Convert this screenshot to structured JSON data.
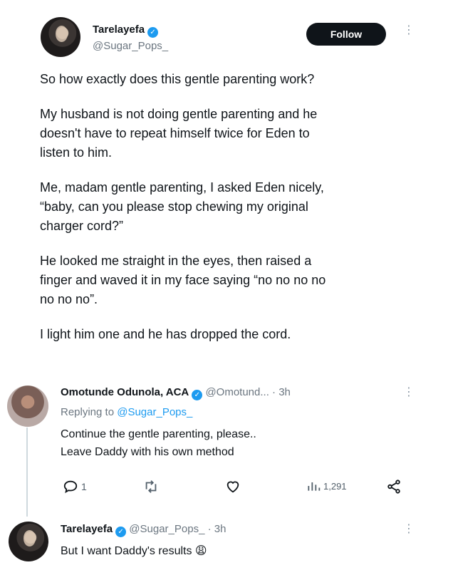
{
  "main_tweet": {
    "author_name": "Tarelayefa",
    "author_handle": "@Sugar_Pops_",
    "follow_label": "Follow",
    "paragraphs": [
      [
        "So how exactly does this gentle parenting work?"
      ],
      [
        "My husband is not doing gentle parenting and he",
        "doesn't have to repeat himself twice for Eden to",
        "listen to him."
      ],
      [
        "Me, madam gentle parenting, I asked Eden nicely,",
        "“baby, can you please stop chewing my original",
        "charger cord?”"
      ],
      [
        "He looked me straight in the eyes, then raised a",
        "finger and waved it in my face saying “no no no no",
        "no no no”."
      ],
      [
        "I light him one and he has dropped the cord."
      ]
    ]
  },
  "reply1": {
    "author_name": "Omotunde Odunola, ACA",
    "author_handle": "@Omotund...",
    "time": "· 3h",
    "replying_to_prefix": "Replying to",
    "replying_to_handle": "@Sugar_Pops_",
    "lines": [
      "Continue the gentle parenting, please..",
      "Leave Daddy with his own method"
    ],
    "actions": {
      "replies": "1",
      "views": "1,291"
    }
  },
  "reply2": {
    "author_name": "Tarelayefa",
    "author_handle": "@Sugar_Pops_",
    "time": "· 3h",
    "text": "But I want Daddy's results",
    "emoji": "😩"
  },
  "colors": {
    "verified": "#1d9bf0",
    "link": "#1d9bf0",
    "follow_bg": "#0f1419",
    "muted": "#6b7680"
  },
  "icons": [
    "verified-badge-icon",
    "more-options-icon",
    "reply-icon",
    "retweet-icon",
    "like-icon",
    "views-icon",
    "share-icon"
  ]
}
